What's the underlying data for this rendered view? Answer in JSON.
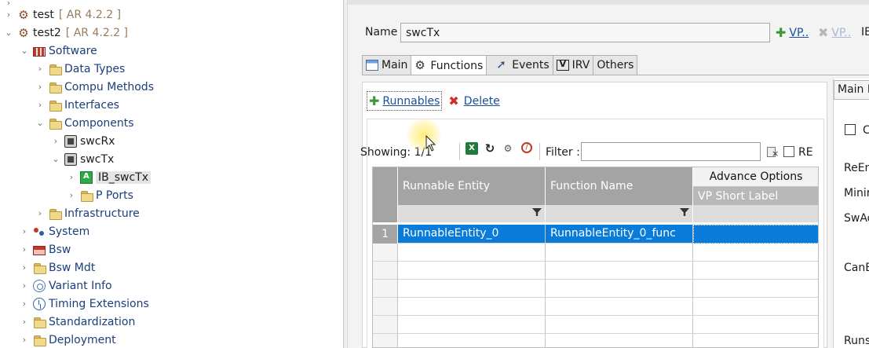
{
  "tree": {
    "items": [
      {
        "label": "test",
        "suffix": "[ AR 4.2.2 ]",
        "indent": 0,
        "expanded": false,
        "icon": "autosar-project-icon"
      },
      {
        "label": "test2",
        "suffix": "[ AR 4.2.2 ]",
        "indent": 0,
        "expanded": true,
        "icon": "autosar-project-icon"
      },
      {
        "label": "Software",
        "indent": 1,
        "expanded": true,
        "icon": "software-icon"
      },
      {
        "label": "Data Types",
        "indent": 2,
        "expanded": false,
        "icon": "folder-icon"
      },
      {
        "label": "Compu Methods",
        "indent": 2,
        "expanded": false,
        "icon": "folder-icon"
      },
      {
        "label": "Interfaces",
        "indent": 2,
        "expanded": false,
        "icon": "folder-icon"
      },
      {
        "label": "Components",
        "indent": 2,
        "expanded": true,
        "icon": "folder-icon"
      },
      {
        "label": "swcRx",
        "indent": 3,
        "expanded": false,
        "icon": "component-icon"
      },
      {
        "label": "swcTx",
        "indent": 3,
        "expanded": true,
        "icon": "component-icon"
      },
      {
        "label": "IB_swcTx",
        "indent": 4,
        "expanded": false,
        "icon": "internal-behavior-icon",
        "selected": true
      },
      {
        "label": "P Ports",
        "indent": 4,
        "expanded": false,
        "icon": "folder-icon"
      },
      {
        "label": "Infrastructure",
        "indent": 2,
        "expanded": false,
        "icon": "folder-icon"
      },
      {
        "label": "System",
        "indent": 1,
        "expanded": false,
        "icon": "system-icon"
      },
      {
        "label": "Bsw",
        "indent": 1,
        "expanded": false,
        "icon": "bsw-icon"
      },
      {
        "label": "Bsw Mdt",
        "indent": 1,
        "expanded": false,
        "icon": "folder-icon"
      },
      {
        "label": "Variant Info",
        "indent": 1,
        "expanded": false,
        "icon": "variant-icon"
      },
      {
        "label": "Timing Extensions",
        "indent": 1,
        "expanded": false,
        "icon": "timing-icon"
      },
      {
        "label": "Standardization",
        "indent": 1,
        "expanded": false,
        "icon": "folder-icon"
      },
      {
        "label": "Deployment",
        "indent": 1,
        "expanded": false,
        "icon": "folder-icon"
      }
    ]
  },
  "editor": {
    "name_label": "Name",
    "name_value": "swcTx",
    "vp_add_label": "VP..",
    "vp_remove_label": "VP..",
    "cut_label": "IB",
    "tabs": [
      {
        "label": "Main",
        "icon": "main-icon",
        "active": false
      },
      {
        "label": "Functions",
        "icon": "functions-icon",
        "active": true
      },
      {
        "label": "Events",
        "icon": "events-icon",
        "active": false
      },
      {
        "label": "IRV",
        "icon": "irv-icon",
        "active": false
      },
      {
        "label": "Others",
        "icon": "",
        "active": false
      }
    ],
    "toolbar": {
      "runnables_label": "Runnables",
      "delete_label": "Delete"
    },
    "showing": "Showing: 1/1",
    "filter_label": "Filter :",
    "filter_value": "",
    "re_label": "RE",
    "table": {
      "columns": [
        "Runnable Entity",
        "Function Name"
      ],
      "group_header": "Advance Options",
      "group_sub": "VP Short Label",
      "rows": [
        {
          "num": "1",
          "runnable": "RunnableEntity_0",
          "function": "RunnableEntity_0_func",
          "vp": "",
          "selected": true
        }
      ]
    },
    "right_panel": {
      "tab_label": "Main P",
      "items": [
        "C",
        "ReEn",
        "Minir",
        "SwAd",
        "CanE",
        "Runs"
      ]
    }
  }
}
